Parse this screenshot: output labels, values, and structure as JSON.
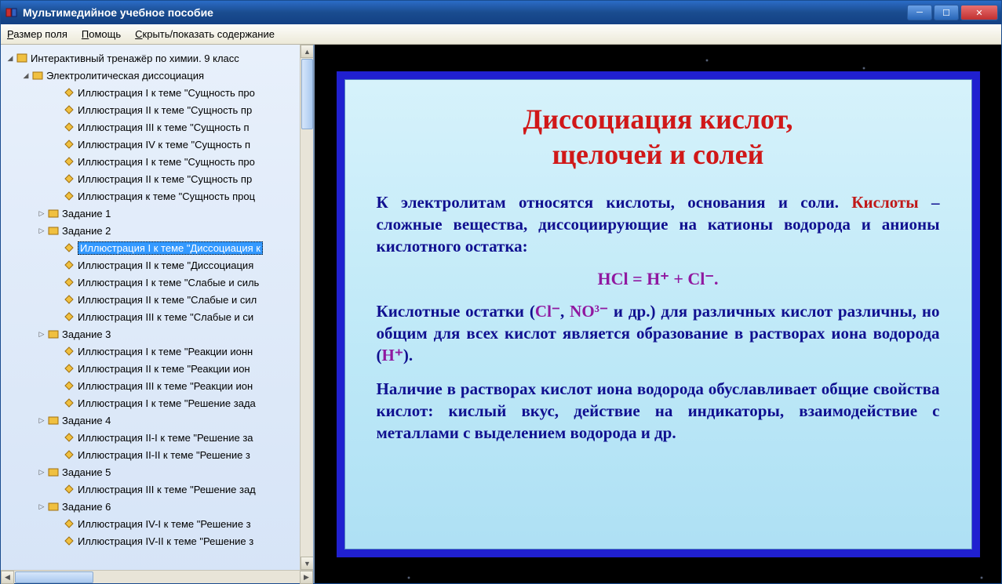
{
  "window": {
    "title": "Мультимедийное учебное пособие"
  },
  "menu": {
    "field_size": "Размер поля",
    "help": "Помощь",
    "toggle_toc": "Скрыть/показать содержание"
  },
  "tree": {
    "root": "Интерактивный тренажёр по химии. 9 класс",
    "section": "Электролитическая диссоциация",
    "items": [
      "Иллюстрация I к теме \"Сущность про",
      "Иллюстрация II к теме \"Сущность пр",
      "Иллюстрация III к теме \"Сущность п",
      "Иллюстрация IV к теме \"Сущность п",
      "Иллюстрация I к теме \"Сущность про",
      "Иллюстрация II к теме \"Сущность пр",
      "Иллюстрация к теме \"Сущность проц"
    ],
    "task1": "Задание 1",
    "task2": "Задание 2",
    "task2_items": [
      "Иллюстрация I к теме \"Диссоциация к",
      "Иллюстрация II к теме \"Диссоциация",
      "Иллюстрация I к теме \"Слабые и силь",
      "Иллюстрация II к теме \"Слабые и сил",
      "Иллюстрация III к теме \"Слабые и си"
    ],
    "task3": "Задание 3",
    "task3_items": [
      "Иллюстрация I к теме \"Реакции ионн",
      "Иллюстрация II к теме \"Реакции ион",
      "Иллюстрация III к теме \"Реакции ион",
      "Иллюстрация I к теме \"Решение зада"
    ],
    "task4": "Задание 4",
    "task4_items": [
      "Иллюстрация II-I к теме \"Решение за",
      "Иллюстрация II-II к теме \"Решение з"
    ],
    "task5": "Задание 5",
    "task5_items": [
      "Иллюстрация III к теме \"Решение зад"
    ],
    "task6": "Задание 6",
    "task6_items": [
      "Иллюстрация IV-I к теме \"Решение з",
      "Иллюстрация IV-II к теме \"Решение з"
    ]
  },
  "slide": {
    "title_l1": "Диссоциация кислот,",
    "title_l2": "щелочей и солей",
    "p1_a": "К электролитам относятся кислоты, основания и соли.",
    "p1_b_red": "Кислоты",
    "p1_b_rest": " – сложные вещества, диссоциирующие на ка­тионы водорода и анионы кислотного остатка:",
    "formula": "HCl  =  H⁺ + Cl⁻.",
    "p2_a": "Кислотные остатки (",
    "p2_cl": "Cl⁻",
    "p2_sep": ", ",
    "p2_no3": "NO³⁻",
    "p2_b": " и др.) для различных кис­лот различны, но общим для всех кислот является об­разование в растворах иона водорода (",
    "p2_h": "H⁺",
    "p2_end": ").",
    "p3": "Наличие в растворах кислот иона водорода обуславли­вает общие свойства кислот: кислый вкус, действие на индикаторы, взаимодействие с металлами с выделением водорода и др."
  }
}
